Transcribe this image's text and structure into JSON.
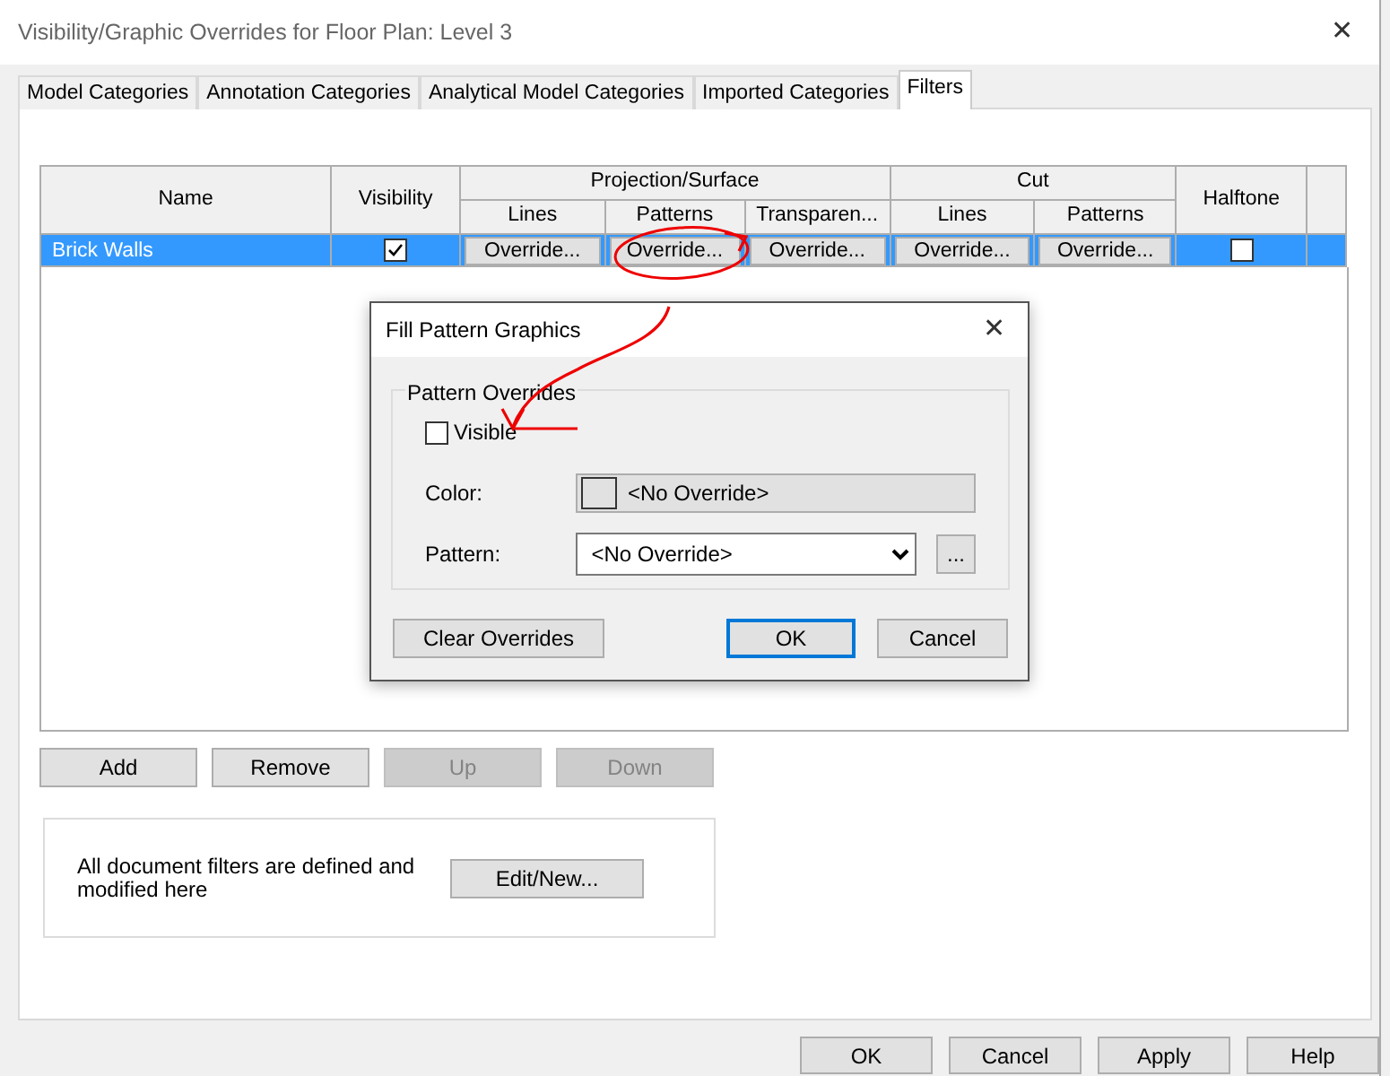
{
  "window": {
    "title": "Visibility/Graphic Overrides for Floor Plan: Level 3",
    "close": "✕"
  },
  "tabs": [
    {
      "label": "Model Categories",
      "selected": false
    },
    {
      "label": "Annotation Categories",
      "selected": false
    },
    {
      "label": "Analytical Model Categories",
      "selected": false
    },
    {
      "label": "Imported Categories",
      "selected": false
    },
    {
      "label": "Filters",
      "selected": true
    }
  ],
  "table": {
    "columns": [
      "Name",
      "Visibility",
      "Projection/Surface",
      "Cut",
      "Halftone"
    ],
    "subcolumns": [
      "Lines",
      "Patterns",
      "Transparen...",
      "Lines",
      "Patterns"
    ],
    "rows": [
      {
        "name": "Brick Walls",
        "selected": true,
        "visible": true,
        "overrides": [
          "Override...",
          "Override...",
          "Override...",
          "Override...",
          "Override..."
        ],
        "halftone": false
      }
    ]
  },
  "list_buttons": [
    {
      "label": "Add",
      "disabled": false
    },
    {
      "label": "Remove",
      "disabled": false
    },
    {
      "label": "Up",
      "disabled": true
    },
    {
      "label": "Down",
      "disabled": true
    }
  ],
  "filters_note": {
    "text": "All document filters are defined and modified here",
    "button": "Edit/New..."
  },
  "footer_buttons": [
    "OK",
    "Cancel",
    "Apply",
    "Help"
  ],
  "dialog": {
    "title": "Fill Pattern Graphics",
    "close": "✕",
    "group": "Pattern Overrides",
    "visible": {
      "label": "Visible",
      "checked": false
    },
    "color": {
      "label": "Color:",
      "value": "<No Override>"
    },
    "pattern": {
      "label": "Pattern:",
      "value": "<No Override>",
      "browse": "..."
    },
    "buttons": [
      {
        "label": "Clear Overrides",
        "default": false
      },
      {
        "label": "OK",
        "default": true
      },
      {
        "label": "Cancel",
        "default": false
      }
    ]
  }
}
